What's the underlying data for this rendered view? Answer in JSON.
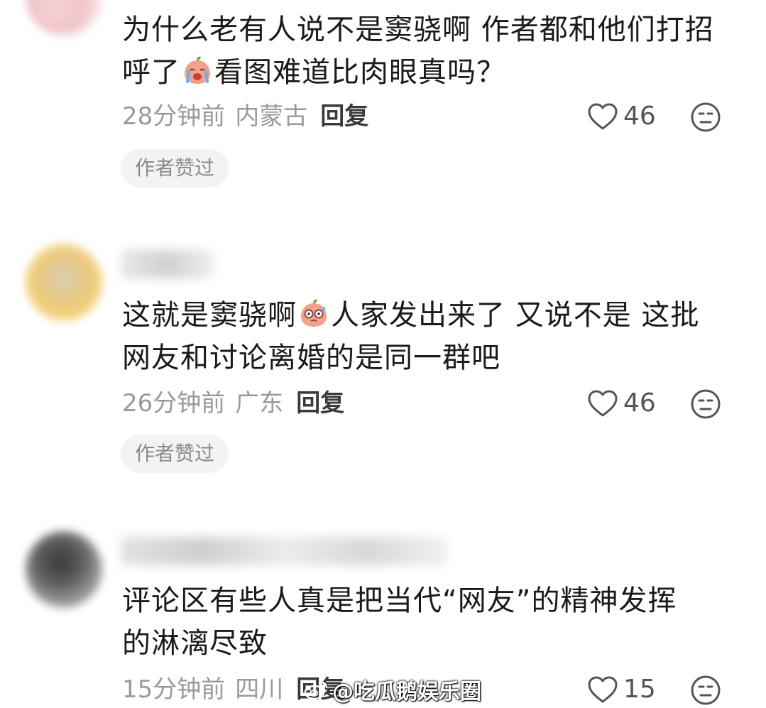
{
  "comments": [
    {
      "text_line1": "为什么老有人说不是窦骁啊 作者都和他们打招",
      "text_line2_pre": "呼了",
      "text_line2_post": "看图难道比肉眼真吗？",
      "emoji": "crying-peach-emoji",
      "time": "28分钟前",
      "location": "内蒙古",
      "reply": "回复",
      "likes": "46",
      "badge": "作者赞过"
    },
    {
      "text_line1_pre": "这就是窦骁啊",
      "text_line1_post": "人家发出来了 又说不是 这批",
      "text_line2": "网友和讨论离婚的是同一群吧",
      "emoji": "sweating-peach-glasses-emoji",
      "time": "26分钟前",
      "location": "广东",
      "reply": "回复",
      "likes": "46",
      "badge": "作者赞过"
    },
    {
      "text_line1": "评论区有些人真是把当代“网友”的精神发挥",
      "text_line2": "的淋漓尽致",
      "time": "15分钟前",
      "location": "四川",
      "reply": "回复",
      "likes": "15"
    }
  ],
  "icons": {
    "like": "heart-outline-icon",
    "dislike": "neutral-face-icon",
    "watermark": "weibo-logo-icon"
  },
  "watermark": {
    "text": "@吃瓜鹅娱乐圈"
  },
  "colors": {
    "text": "#1a1a1a",
    "meta": "#9a9a9a",
    "badge_bg": "#f3f3f3",
    "emoji_peach": "#f3a08c"
  }
}
